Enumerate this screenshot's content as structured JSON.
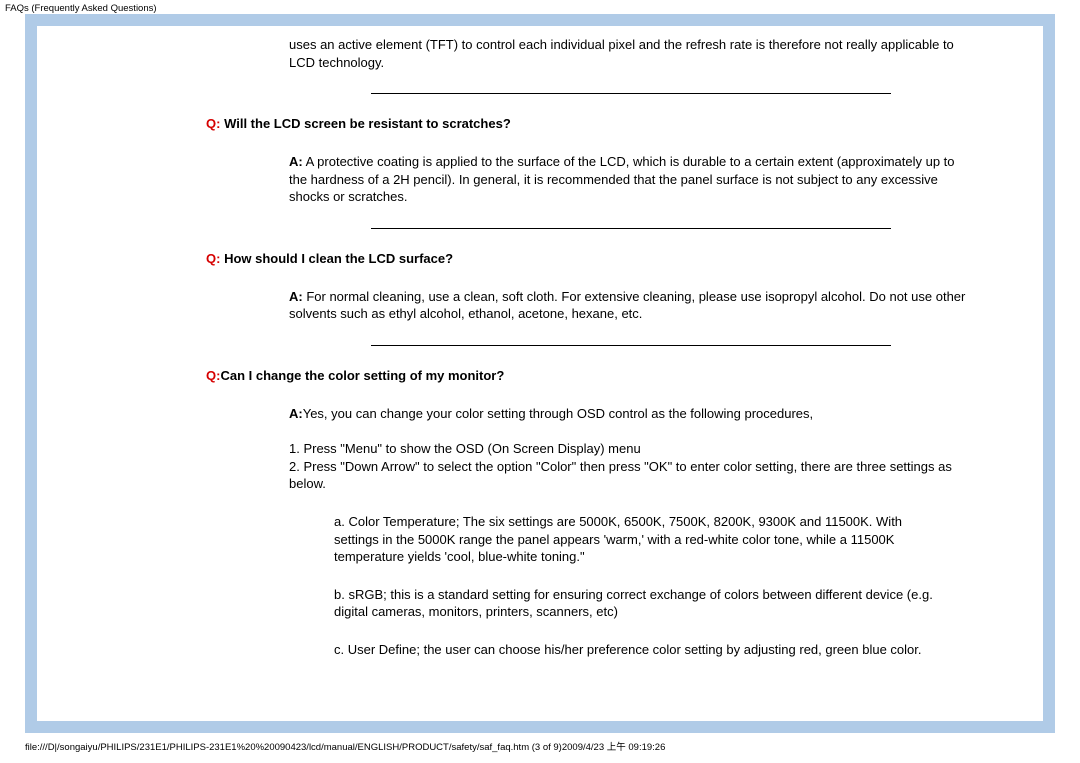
{
  "header": "FAQs (Frequently Asked Questions)",
  "intro": "uses an active element (TFT) to control each individual pixel and the refresh rate is therefore not really applicable to LCD technology.",
  "faqs": [
    {
      "q_label": "Q:",
      "question": " Will the LCD screen be resistant to scratches?",
      "a_label": "A:",
      "answer": " A protective coating is applied to the surface of the LCD, which is durable to a certain extent (approximately up to the hardness of a 2H pencil). In general, it is recommended that the panel surface is not subject to any excessive shocks or scratches."
    },
    {
      "q_label": "Q:",
      "question": " How should I clean the LCD surface?",
      "a_label": "A:",
      "answer": " For normal cleaning, use a clean, soft cloth. For extensive cleaning, please use isopropyl alcohol. Do not use other solvents such as ethyl alcohol, ethanol, acetone, hexane, etc."
    },
    {
      "q_label": "Q:",
      "question": "Can I change the color setting of my monitor?",
      "a_label": "A:",
      "answer": "Yes, you can change your color setting through OSD control as the following procedures,",
      "step1": "1. Press \"Menu\" to show the OSD (On Screen Display) menu",
      "step2": "2. Press \"Down Arrow\" to select the option \"Color\" then press \"OK\" to enter color setting, there are three settings as below.",
      "sub_a": "a. Color Temperature; The six settings are  5000K, 6500K, 7500K, 8200K, 9300K and 11500K. With settings in the 5000K range the panel appears 'warm,' with a red-white color tone, while a 11500K temperature yields 'cool, blue-white toning.\"",
      "sub_b": "b. sRGB; this is a standard setting for ensuring correct exchange of colors between different device (e.g. digital cameras, monitors, printers, scanners, etc)",
      "sub_c": "c. User Define; the user can choose his/her preference color setting by adjusting red, green blue color."
    }
  ],
  "footer": "file:///D|/songaiyu/PHILIPS/231E1/PHILIPS-231E1%20%20090423/lcd/manual/ENGLISH/PRODUCT/safety/saf_faq.htm (3 of 9)2009/4/23 上午 09:19:26"
}
